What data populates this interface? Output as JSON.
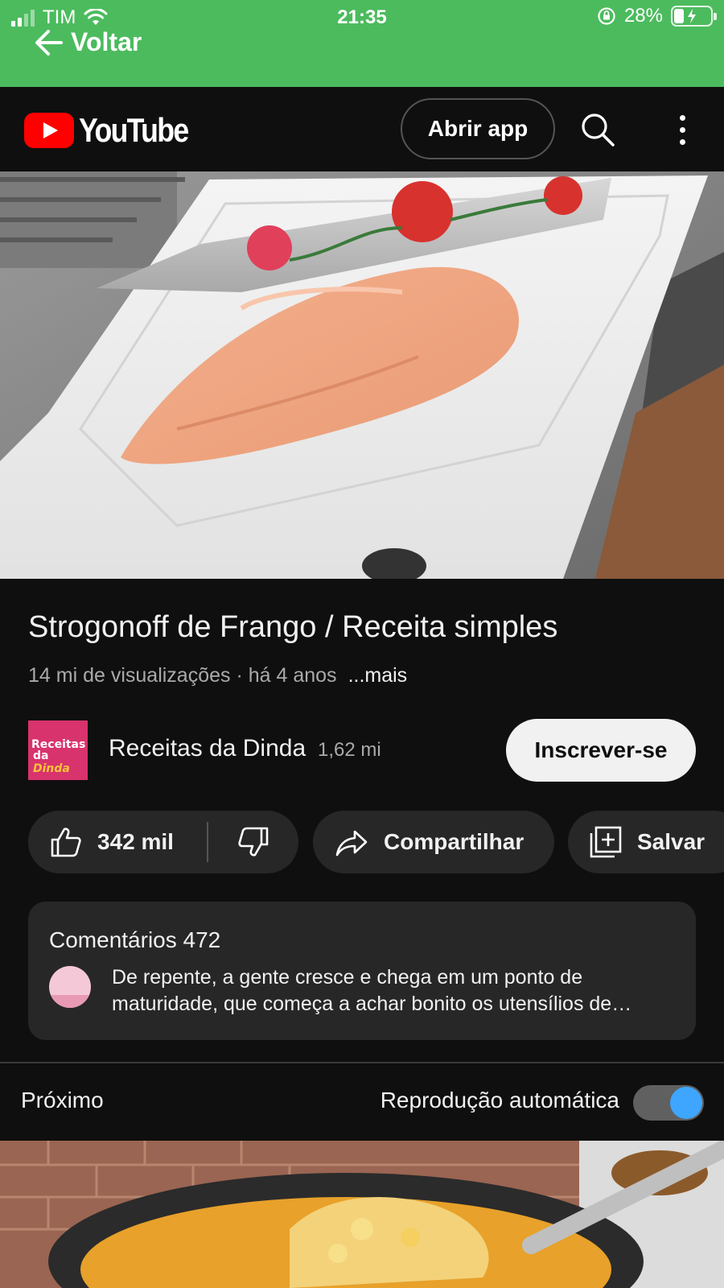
{
  "status_bar": {
    "carrier": "TIM",
    "time": "21:35",
    "battery": "28%",
    "battery_level": 0.28
  },
  "nav": {
    "back_label": "Voltar"
  },
  "header": {
    "logo_text": "YouTube",
    "open_app_label": "Abrir app",
    "icons": [
      "search-icon",
      "more-vertical-icon"
    ]
  },
  "video": {
    "title": "Strogonoff de Frango / Receita simples",
    "views": "14 mi de visualizações",
    "separator": " · ",
    "age": "há 4 anos",
    "more_label": "...mais"
  },
  "channel": {
    "avatar_text_line1": "Receitas",
    "avatar_text_line2a": "da",
    "avatar_text_line2b": "Dinda",
    "name": "Receitas da Dinda",
    "subscribers": "1,62 mi",
    "subscribe_label": "Inscrever-se"
  },
  "actions": {
    "likes": "342 mil",
    "share_label": "Compartilhar",
    "save_label": "Salvar"
  },
  "comments": {
    "title": "Comentários 472",
    "top_comment": "De repente, a gente cresce e chega em um ponto de maturidade, que começa a achar bonito os utensílios de…"
  },
  "up_next": {
    "label": "Próximo",
    "autoplay_label": "Reprodução automática",
    "autoplay_on": true
  },
  "colors": {
    "status_bar_bg": "#4cbb5e",
    "page_bg": "#0f0f0f",
    "pill_bg": "#272727",
    "brand_red": "#ff0000",
    "toggle_accent": "#3ea6ff"
  }
}
